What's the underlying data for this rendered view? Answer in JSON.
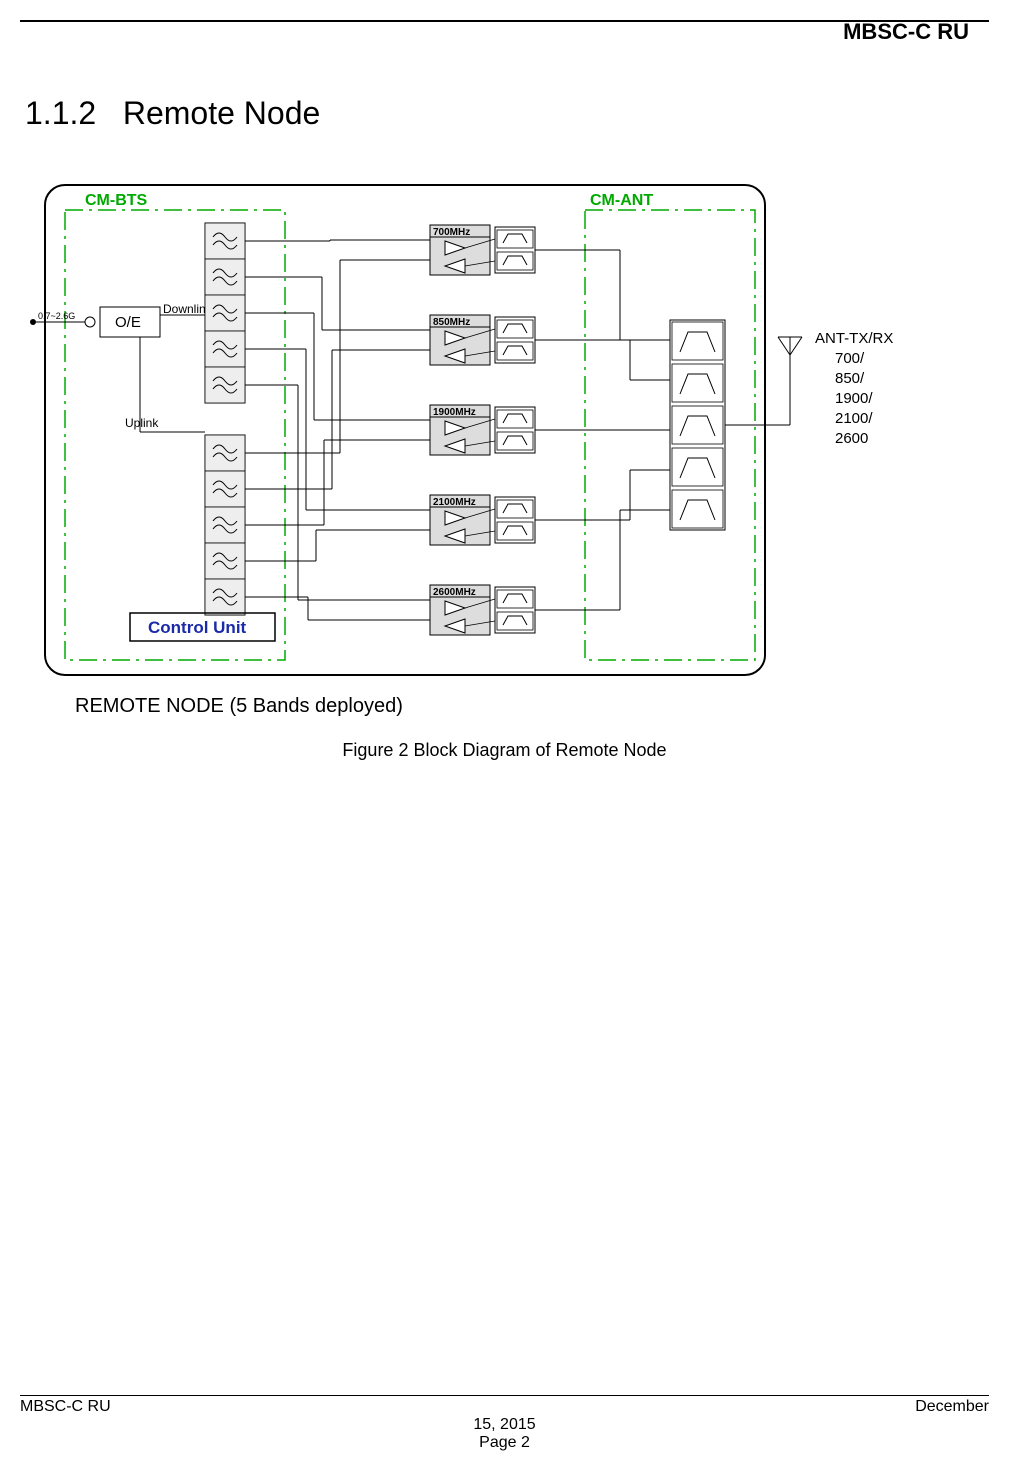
{
  "header": {
    "title": "MBSC-C RU"
  },
  "section": {
    "number": "1.1.2",
    "title": "Remote Node"
  },
  "diagram": {
    "cm_bts_label": "CM-BTS",
    "cm_ant_label": "CM-ANT",
    "oe_label": "O/E",
    "downlink_label": "Downlink",
    "uplink_label": "Uplink",
    "control_unit_label": "Control Unit",
    "input_freq_label": "0.7~2.6G",
    "bands": [
      "700MHz",
      "850MHz",
      "1900MHz",
      "2100MHz",
      "2600MHz"
    ],
    "antenna": {
      "title": "ANT-TX/RX",
      "lines": [
        "700/",
        "850/",
        "1900/",
        "2100/",
        "2600"
      ]
    }
  },
  "subtitle": "REMOTE  NODE (5 Bands deployed)",
  "figure_caption": "Figure 2 Block Diagram of Remote Node",
  "footer": {
    "left": "MBSC-C RU",
    "right": "December",
    "center1": "15, 2015",
    "center2": "Page 2"
  }
}
